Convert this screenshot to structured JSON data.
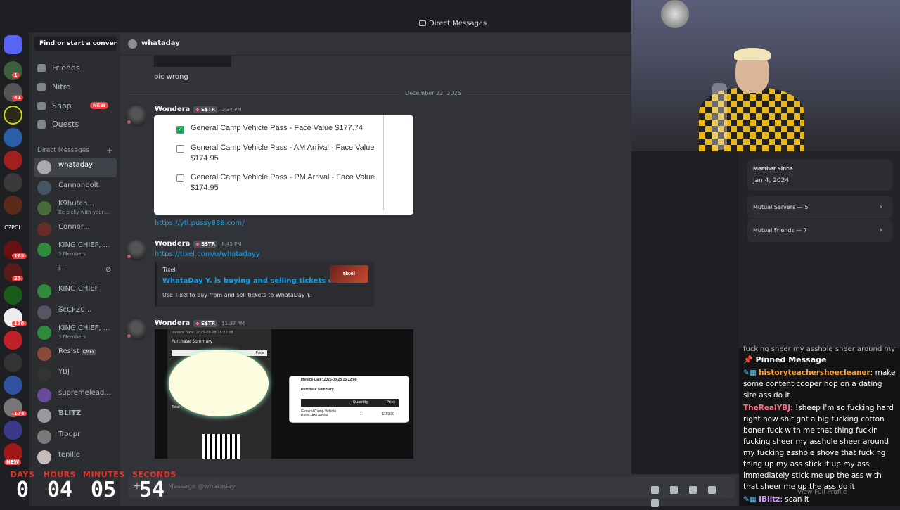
{
  "topbar": {
    "title": "Direct Messages"
  },
  "rail": {
    "badges": [
      "1",
      "41",
      "169",
      "23",
      "136",
      "174"
    ],
    "labels": [
      "C?PCL",
      "NEW"
    ]
  },
  "sidebar": {
    "search_placeholder": "Find or start a convers...",
    "nav": [
      {
        "label": "Friends",
        "icon": "friends-icon"
      },
      {
        "label": "Nitro",
        "icon": "nitro-icon"
      },
      {
        "label": "Shop",
        "icon": "shop-icon",
        "badge": "NEW"
      },
      {
        "label": "Quests",
        "icon": "quests-icon"
      }
    ],
    "dm_header": "Direct Messages",
    "dms": [
      {
        "name": "whataday",
        "sub": ""
      },
      {
        "name": "Cannonbolt",
        "sub": ""
      },
      {
        "name": "K9hutch...",
        "sub": "Be picky with your ..."
      },
      {
        "name": "Connor...",
        "sub": ""
      },
      {
        "name": "KING CHIEF, ...",
        "sub": "5 Members"
      },
      {
        "name": "j...",
        "sub": ""
      },
      {
        "name": "KING CHIEF",
        "sub": ""
      },
      {
        "name": "ᘔcCFZ0...",
        "sub": ""
      },
      {
        "name": "KING CHIEF, ...",
        "sub": "3 Members"
      },
      {
        "name": "Resist",
        "sub": ""
      },
      {
        "name": "YBJ",
        "sub": ""
      },
      {
        "name": "supremelead...",
        "sub": ""
      },
      {
        "name": "ƁLITZ",
        "sub": ""
      },
      {
        "name": "Troopr",
        "sub": ""
      },
      {
        "name": "tenille",
        "sub": ""
      }
    ],
    "resist_tag": "CMFY"
  },
  "chat_header": {
    "name": "whataday"
  },
  "chat": {
    "first_msg": "bic wrong",
    "date_divider": "December 22, 2025",
    "author": "Wondera",
    "tag": "S$TR",
    "messages": [
      {
        "time": "2:34 PM",
        "link": "https://ytl.pussy888.com/"
      },
      {
        "time": "8:45 PM",
        "link": "https://tixel.com/u/whatadayy"
      },
      {
        "time": "11:37 PM",
        "link": ""
      }
    ],
    "screenshot_rows": [
      {
        "text": "General Camp Vehicle Pass - Face Value $177.74",
        "checked": true
      },
      {
        "text": "General Camp Vehicle Pass - AM Arrival - Face Value $174.95",
        "checked": false
      },
      {
        "text": "General Camp Vehicle Pass - PM Arrival - Face Value $174.95",
        "checked": false
      }
    ],
    "embed": {
      "provider": "Tixel",
      "title": "WhataDay Y. is buying and selling tickets on Tixel",
      "description": "Use Tixel to buy from and sell tickets to WhataDay Y.",
      "thumb": "tixel"
    },
    "invoice": {
      "date": "Invoice Date: 2025-08-28 16:22:08",
      "summary": "Purchase Summary",
      "col_qty": "Quantity",
      "col_price": "Price",
      "item": "General Camp Vehicle Pass - AM Arrival",
      "qty": "1",
      "price": "$159.00",
      "left_total": "Total",
      "left_price": "Price"
    },
    "composer_placeholder": "Message @whataday"
  },
  "profile": {
    "member_since_label": "Member Since",
    "member_since": "Jan 4, 2024",
    "mutual_servers": "Mutual Servers — 5",
    "mutual_friends": "Mutual Friends — 7"
  },
  "stream_chat": {
    "faded_top": "fucking sheer my asshole sheer around my",
    "pinned": "Pinned Message",
    "lines": [
      {
        "user": "historyteachershoecleaner",
        "text": ": make some content cooper hop on a dating site ass do it"
      },
      {
        "user": "TheRealYBJ",
        "text": ": !sheep I'm so fucking hard right now shit got a big fucking cotton boner fuck with me that thing fuckin fucking sheer my asshole sheer around my fucking asshole shove that fucking thing up my ass stick it up my ass immediately stick me up the ass with that sheer me up the ass do it"
      },
      {
        "user": "IBlitz",
        "text": ": scan it"
      }
    ],
    "view_full_profile": "View Full Profile"
  },
  "countdown": [
    {
      "label": "DAYS",
      "value": "0"
    },
    {
      "label": "HOURS",
      "value": "04"
    },
    {
      "label": "MINUTES",
      "value": "05"
    },
    {
      "label": "SECONDS",
      "value": "54"
    }
  ]
}
